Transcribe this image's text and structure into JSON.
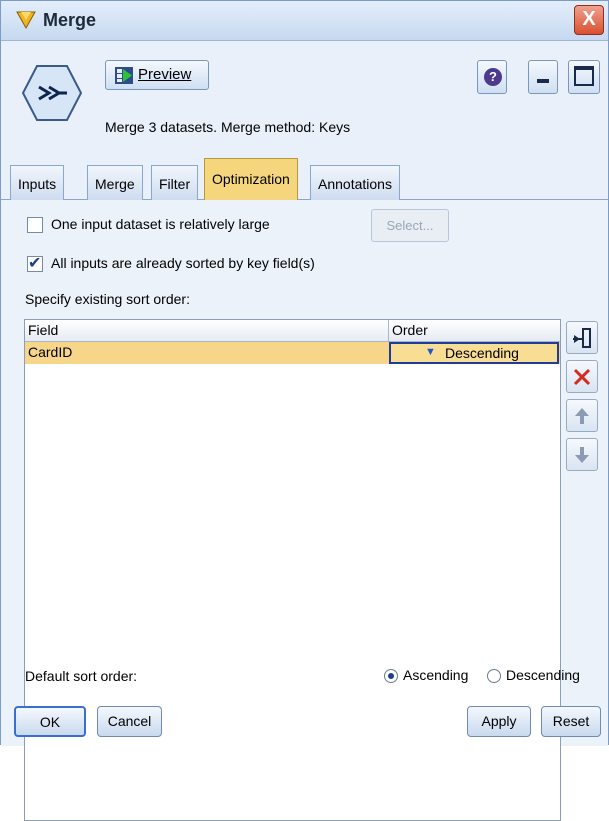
{
  "window": {
    "title": "Merge",
    "close_glyph": "X"
  },
  "header": {
    "preview_label": "Preview",
    "help_glyph": "?",
    "description": "Merge 3 datasets. Merge method: Keys"
  },
  "tabs": [
    {
      "label": "Inputs",
      "active": false
    },
    {
      "label": "Merge",
      "active": false
    },
    {
      "label": "Filter",
      "active": false
    },
    {
      "label": "Optimization",
      "active": true
    },
    {
      "label": "Annotations",
      "active": false
    }
  ],
  "optimization": {
    "large_input_label": "One input dataset is relatively large",
    "large_input_checked": false,
    "select_label": "Select...",
    "sorted_label": "All inputs are already sorted by key field(s)",
    "sorted_checked": true,
    "specify_label": "Specify existing sort order:"
  },
  "table": {
    "columns": [
      "Field",
      "Order"
    ],
    "rows": [
      {
        "field": "CardID",
        "order": "Descending"
      }
    ]
  },
  "sort": {
    "default_label": "Default sort order:",
    "options": [
      "Ascending",
      "Descending"
    ],
    "selected": "Ascending"
  },
  "buttons": {
    "ok": "OK",
    "cancel": "Cancel",
    "apply": "Apply",
    "reset": "Reset"
  },
  "colors": {
    "selected_tab": "#f5d67c",
    "selected_row": "#f7d68a",
    "accent": "#1b3f8f"
  }
}
